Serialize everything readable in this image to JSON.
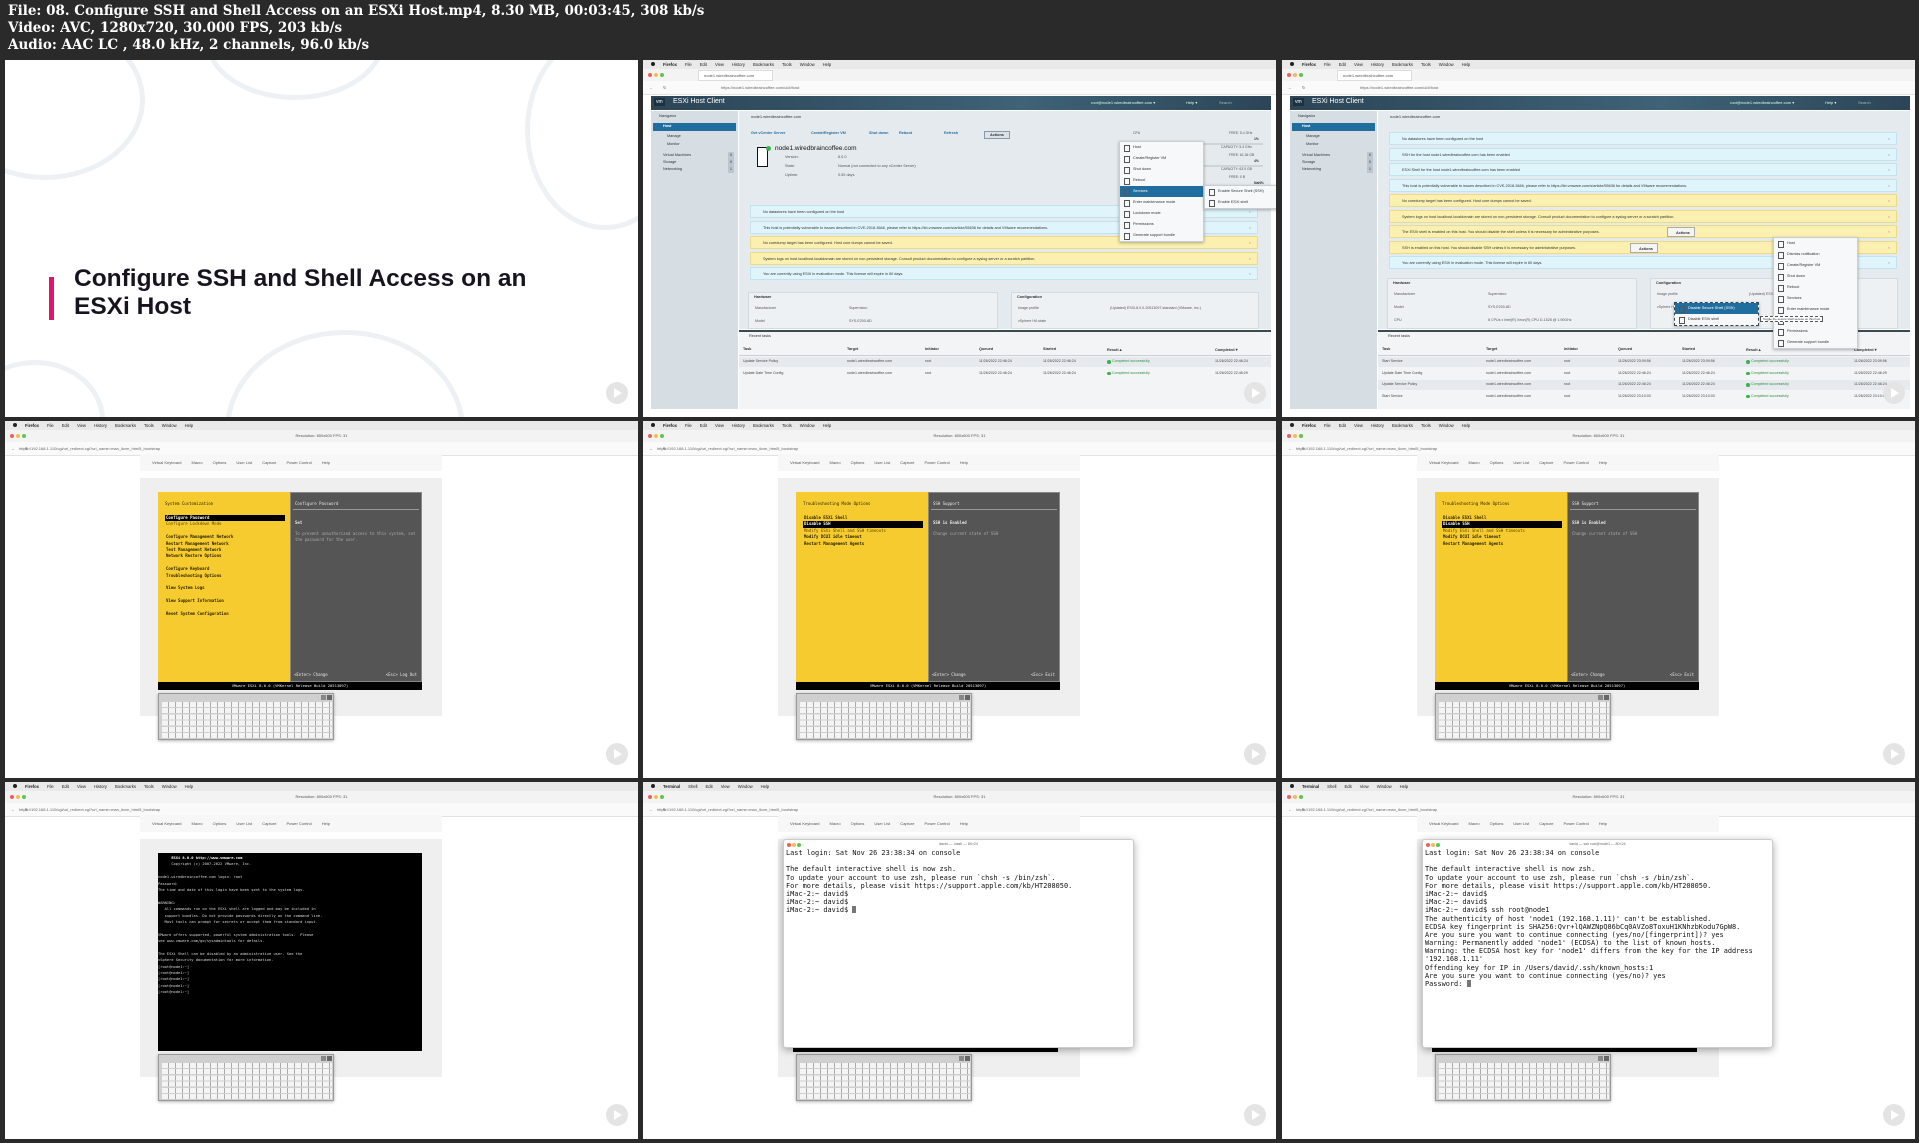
{
  "header": {
    "file_line": "File: 08. Configure SSH and Shell Access on an ESXi Host.mp4, 8.30 MB, 00:03:45, 308 kb/s",
    "video_line": "Video: AVC, 1280x720, 30.000 FPS, 203 kb/s",
    "audio_line": "Audio: AAC LC , 48.0 kHz, 2 channels, 96.0 kb/s"
  },
  "colors": {
    "accent": "#e0156b",
    "esxi_header": "#2c4557",
    "dcui_yellow": "#f6cb2f",
    "dcui_gray": "#555555",
    "info_alert": "#dff4fb",
    "warn_alert": "#fbf0b0"
  },
  "slide": {
    "title": "Configure SSH and Shell Access on an ESXi Host"
  },
  "firefox_menu": [
    "Firefox",
    "File",
    "Edit",
    "View",
    "History",
    "Bookmarks",
    "Tools",
    "Window",
    "Help"
  ],
  "terminal_menu": [
    "Terminal",
    "Shell",
    "Edit",
    "View",
    "Window",
    "Help"
  ],
  "esxi": {
    "tab_title": "node1.wiredbraincoffee.com",
    "url": "https://node1.wiredbraincoffee.com/ui/#/host",
    "zoom": "90%",
    "app_title": "ESXi Host Client",
    "logo": "vm",
    "user": "root@node1.wiredbraincoffee.com ▾",
    "help": "Help ▾",
    "search_placeholder": "Search",
    "navigator": "Navigator",
    "nav_items": [
      {
        "label": "Host",
        "count": ""
      },
      {
        "label": "Manage",
        "count": ""
      },
      {
        "label": "Monitor",
        "count": ""
      },
      {
        "label": "Virtual Machines",
        "count": "0"
      },
      {
        "label": "Storage",
        "count": "0"
      },
      {
        "label": "Networking",
        "count": "1"
      }
    ],
    "breadcrumb": "node1.wiredbraincoffee.com",
    "toolbar": [
      "Get vCenter Server",
      "Create/Register VM",
      "Shut down",
      "Reboot",
      "Refresh",
      "Actions"
    ],
    "host_name": "node1.wiredbraincoffee.com",
    "host_info": [
      {
        "k": "Version:",
        "v": "8.0.0"
      },
      {
        "k": "State:",
        "v": "Normal (not connected to any vCenter Server)"
      },
      {
        "k": "Uptime:",
        "v": "0.59 days"
      }
    ],
    "resources": [
      {
        "name": "CPU",
        "free": "FREE: 5.4 GHz",
        "pct": "1%",
        "used": "USED: 83 MHz",
        "cap": "CAPACITY: 5.4 GHz"
      },
      {
        "name": "MEMORY",
        "free": "FREE: 61.36 GB",
        "pct": "4%",
        "used": "USED: 2.54 GB",
        "cap": "CAPACITY: 63.9 GB"
      },
      {
        "name": "STORAGE",
        "free": "FREE: 0 B",
        "pct": "NaN%",
        "used": "USED: 0 B",
        "cap": "CAPACITY: 0 B"
      }
    ],
    "hardware_title": "Hardware",
    "hardware": [
      {
        "k": "Manufacturer",
        "v": "Supermicro"
      },
      {
        "k": "Model",
        "v": "SYS-E200-8D"
      },
      {
        "k": "CPU",
        "v": "8 CPUs x Intel(R) Xeon(R) CPU D-1528 @ 1.90GHz"
      },
      {
        "k": "Memory",
        "v": "63.9 GB"
      }
    ],
    "config_title": "Configuration",
    "config": [
      {
        "k": "Image profile",
        "v": "(Updated) ESXi-8.0.0-20513097-standard (VMware, Inc.)"
      },
      {
        "k": "vSphere HA state",
        "v": ""
      }
    ],
    "tasks_title": "Recent tasks",
    "task_columns": [
      "Task",
      "Target",
      "Initiator",
      "Queued",
      "Started",
      "Result ▴",
      "Completed ▾"
    ],
    "actions_menu": [
      "Host",
      "Create/Register VM",
      "Shut down",
      "Reboot",
      "Services",
      "Enter maintenance mode",
      "Lockdown mode",
      "Permissions",
      "Generate support bundle"
    ],
    "actions_menu_2": [
      "Host",
      "Dismiss notification",
      "Create/Register VM",
      "Shut down",
      "Reboot",
      "Services",
      "Enter maintenance mode",
      "Lockdown mode",
      "Permissions",
      "Generate support bundle"
    ]
  },
  "esxi_frame_1": {
    "alerts": [
      {
        "type": "info",
        "text": "No datastores have been configured on the host"
      },
      {
        "type": "info",
        "text": "This host is potentially vulnerable to issues described in CVE-2018-3646, please refer to https://kb.vmware.com/s/article/55636 for details and VMware recommendations."
      },
      {
        "type": "warn",
        "text": "No coredump target has been configured. Host core dumps cannot be saved."
      },
      {
        "type": "warn",
        "text": "System logs on host localhost.localdomain are stored on non-persistent storage. Consult product documentation to configure a syslog server or a scratch partition."
      },
      {
        "type": "info",
        "text": "You are currently using ESXi in evaluation mode. This license will expire in 60 days."
      }
    ],
    "services_submenu": [
      "Enable Secure Shell (SSH)",
      "Enable ESXi shell"
    ],
    "tasks": [
      [
        "Update Service Policy",
        "node1.wiredbraincoffee.com",
        "root",
        "11/26/2022 22:46:24",
        "11/26/2022 22:46:24",
        "Completed successfully",
        "11/26/2022 22:46:24"
      ],
      [
        "Update Date Time Config",
        "node1.wiredbraincoffee.com",
        "root",
        "11/26/2022 22:46:24",
        "11/26/2022 22:46:24",
        "Completed successfully",
        "11/26/2022 22:46:29"
      ]
    ]
  },
  "esxi_frame_2": {
    "alerts": [
      {
        "type": "info",
        "text": "No datastores have been configured on the host"
      },
      {
        "type": "info",
        "text": "SSH for the host node1.wiredbraincoffee.com has been enabled"
      },
      {
        "type": "info",
        "text": "ESXi Shell for the host node1.wiredbraincoffee.com has been enabled"
      },
      {
        "type": "info",
        "text": "This host is potentially vulnerable to issues described in CVE-2018-3646, please refer to https://kb.vmware.com/s/article/55636 for details and VMware recommendations."
      },
      {
        "type": "warn",
        "text": "No coredump target has been configured. Host core dumps cannot be saved."
      },
      {
        "type": "warn",
        "text": "System logs on host localhost.localdomain are stored on non-persistent storage. Consult product documentation to configure a syslog server or a scratch partition."
      },
      {
        "type": "warn",
        "text": "The ESXi shell is enabled on this host. You should disable the shell unless it is necessary for administrative purposes."
      },
      {
        "type": "warn",
        "text": "SSH is enabled on this host. You should disable SSH unless it is necessary for administrative purposes."
      },
      {
        "type": "info",
        "text": "You are currently using ESXi in evaluation mode. This license will expire in 60 days."
      }
    ],
    "alert_actions": "Actions",
    "services_submenu": [
      "Disable Secure Shell (SSH)",
      "Disable ESXi shell"
    ],
    "tooltip": "Toggle the secure shell service on this host",
    "tasks": [
      [
        "Start Service",
        "node1.wiredbraincoffee.com",
        "root",
        "11/26/2022 23:09:56",
        "11/26/2022 23:09:56",
        "Completed successfully",
        "11/26/2022 23:09:56"
      ],
      [
        "Update Date Time Config",
        "node1.wiredbraincoffee.com",
        "root",
        "11/26/2022 22:46:24",
        "11/26/2022 22:46:24",
        "Completed successfully",
        "11/26/2022 22:46:29"
      ],
      [
        "Update Service Policy",
        "node1.wiredbraincoffee.com",
        "root",
        "11/26/2022 22:46:24",
        "11/26/2022 22:46:24",
        "Completed successfully",
        "11/26/2022 22:46:24"
      ],
      [
        "Start Service",
        "node1.wiredbraincoffee.com",
        "root",
        "11/26/2022 23:10:03",
        "11/26/2022 23:10:03",
        "Completed successfully",
        "11/26/2022 23:10:03"
      ]
    ]
  },
  "console": {
    "window_title": "Resolution: 800x600 FPS: 31",
    "url": "https://192.168.1.110/cgi/url_redirect.cgi?url_name=man_ikvm_html5_bootstrap",
    "toolbar": [
      "Virtual Keyboard",
      "Macro",
      "Options",
      "User List",
      "Capture",
      "Power Control",
      "Help"
    ],
    "dcui_footer": "VMware ESXi 8.0.0 (VMKernel Release Build 20513097)"
  },
  "dcui_1": {
    "left_title": "System Customization",
    "items": [
      {
        "t": "Configure Password",
        "sel": true
      },
      {
        "t": "Configure Lockdown Mode",
        "dim": true
      },
      {
        "t": ""
      },
      {
        "t": "Configure Management Network"
      },
      {
        "t": "Restart Management Network"
      },
      {
        "t": "Test Management Network"
      },
      {
        "t": "Network Restore Options"
      },
      {
        "t": ""
      },
      {
        "t": "Configure Keyboard"
      },
      {
        "t": "Troubleshooting Options"
      },
      {
        "t": ""
      },
      {
        "t": "View System Logs"
      },
      {
        "t": ""
      },
      {
        "t": "View Support Information"
      },
      {
        "t": ""
      },
      {
        "t": "Reset System Configuration"
      }
    ],
    "right_title": "Configure Password",
    "right_heading": "Set",
    "right_desc": "To prevent unauthorized access to this system, set the password for the user.",
    "enter_hint": "<Enter> Change",
    "esc_hint": "<Esc> Log Out"
  },
  "dcui_2": {
    "left_title": "Troubleshooting Mode Options",
    "items": [
      {
        "t": "Disable ESXi Shell"
      },
      {
        "t": "Disable SSH",
        "sel": true
      },
      {
        "t": "Modify ESXi Shell and SSH timeouts",
        "dim": true
      },
      {
        "t": "Modify DCUI idle timeout"
      },
      {
        "t": "Restart Management Agents"
      }
    ],
    "right_title": "SSH Support",
    "right_heading": "SSH is Enabled",
    "right_desc": "Change current state of SSH",
    "enter_hint": "<Enter> Change",
    "esc_hint": "<Esc> Exit"
  },
  "shell": {
    "lines": [
      "      ESXi 8.0.0 http://www.vmware.com",
      "      Copyright (c) 2007-2022 VMware, Inc.",
      "",
      "node1.wiredbraincoffee.com login: root",
      "Password:",
      "The time and date of this login have been sent to the system logs.",
      "",
      "WARNING:",
      "   All commands run on the ESXi shell are logged and may be included in",
      "   support bundles. Do not provide passwords directly on the command line.",
      "   Most tools can prompt for secrets or accept them from standard input.",
      "",
      "VMware offers supported, powerful system administration tools.  Please",
      "see www.vmware.com/go/sysadmintools for details.",
      "",
      "The ESXi Shell can be disabled by an administrative user. See the",
      "vSphere Security documentation for more information.",
      "[root@node1:~]",
      "[root@node1:~]",
      "[root@node1:~]",
      "[root@node1:~]",
      "[root@node1:~]"
    ]
  },
  "terminal_1": {
    "title": "david — -bash — 80×24",
    "lines": [
      "Last login: Sat Nov 26 23:38:34 on console",
      "",
      "The default interactive shell is now zsh.",
      "To update your account to use zsh, please run `chsh -s /bin/zsh`.",
      "For more details, please visit https://support.apple.com/kb/HT208050.",
      "iMac-2:~ david$",
      "iMac-2:~ david$",
      "iMac-2:~ david$ "
    ]
  },
  "terminal_2": {
    "title": "david — ssh root@node1 — 80×24",
    "lines": [
      "Last login: Sat Nov 26 23:38:34 on console",
      "",
      "The default interactive shell is now zsh.",
      "To update your account to use zsh, please run `chsh -s /bin/zsh`.",
      "For more details, please visit https://support.apple.com/kb/HT208050.",
      "iMac-2:~ david$",
      "iMac-2:~ david$",
      "iMac-2:~ david$ ssh root@node1",
      "The authenticity of host 'node1 (192.168.1.11)' can't be established.",
      "ECDSA key fingerprint is SHA256:Qvr+lQAWZNpQ86bCq0AVZo8ToxuH1KNhzbKodu7GpW8.",
      "Are you sure you want to continue connecting (yes/no/[fingerprint])? yes",
      "Warning: Permanently added 'node1' (ECDSA) to the list of known hosts.",
      "Warning: the ECDSA host key for 'node1' differs from the key for the IP address",
      "'192.168.1.11'",
      "Offending key for IP in /Users/david/.ssh/known_hosts:1",
      "Are you sure you want to continue connecting (yes/no)? yes",
      "Password: "
    ]
  }
}
